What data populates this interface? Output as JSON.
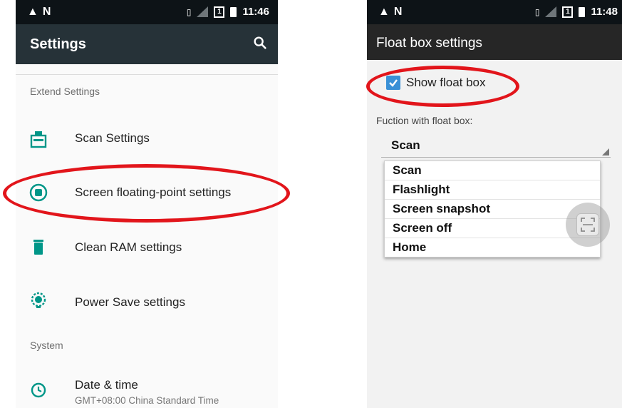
{
  "left": {
    "status_time": "11:46",
    "status_box_text": "1",
    "title": "Settings",
    "section_extend": "Extend Settings",
    "items": [
      {
        "label": "Scan Settings",
        "icon": "scan-settings-icon"
      },
      {
        "label": "Screen floating-point settings",
        "icon": "floating-point-icon"
      },
      {
        "label": "Clean RAM settings",
        "icon": "trash-icon"
      },
      {
        "label": "Power Save settings",
        "icon": "power-save-icon"
      }
    ],
    "section_system": "System",
    "date_time": {
      "label": "Date & time",
      "sub": "GMT+08:00 China Standard Time",
      "icon": "clock-icon"
    },
    "accent_color": "#009688",
    "appbar_color": "#263238"
  },
  "right": {
    "status_time": "11:48",
    "status_box_text": "1",
    "title": "Float box settings",
    "show_float_box": {
      "label": "Show float box",
      "checked": true
    },
    "function_label": "Fuction with float box:",
    "spinner_value": "Scan",
    "options": [
      "Scan",
      "Flashlight",
      "Screen snapshot",
      "Screen off",
      "Home"
    ],
    "checkbox_color": "#3a90d6",
    "highlight_color": "#e2151b"
  }
}
